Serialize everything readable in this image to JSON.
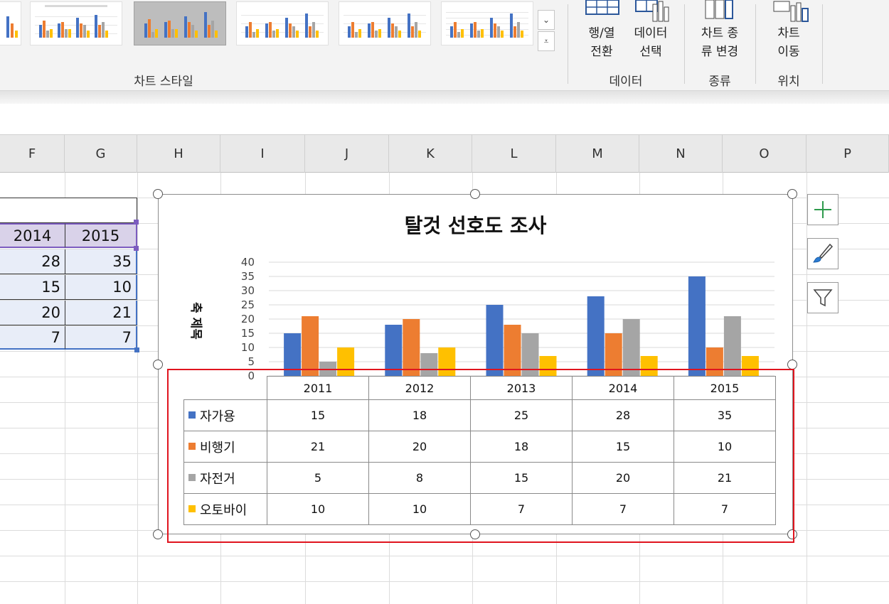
{
  "ribbon": {
    "chart_styles_label": "차트 스타일",
    "data_group_label": "데이터",
    "type_group_label": "종류",
    "location_group_label": "위치",
    "switch_row_col": [
      "행/열",
      "전환"
    ],
    "select_data": [
      "데이터",
      "선택"
    ],
    "change_chart_type": [
      "차트 종",
      "류 변경"
    ],
    "move_chart": [
      "차트",
      "이동"
    ]
  },
  "columns": [
    "F",
    "G",
    "H",
    "I",
    "J",
    "K",
    "L",
    "M",
    "N",
    "O",
    "P"
  ],
  "sheet": {
    "header_cells": [
      "2014",
      "2015"
    ],
    "rows": [
      [
        "28",
        "35"
      ],
      [
        "15",
        "10"
      ],
      [
        "20",
        "21"
      ],
      [
        "7",
        "7"
      ]
    ]
  },
  "chart": {
    "title": "탈것 선호도 조사",
    "axis_title": "축 제목",
    "side_buttons": [
      "plus-icon",
      "brush-icon",
      "filter-icon"
    ],
    "table_headers": [
      "2011",
      "2012",
      "2013",
      "2014",
      "2015"
    ]
  },
  "chart_data": {
    "type": "bar",
    "title": "탈것 선호도 조사",
    "ylabel": "축 제목",
    "xlabel": "",
    "categories": [
      "2011",
      "2012",
      "2013",
      "2014",
      "2015"
    ],
    "ylim": [
      0,
      40
    ],
    "yticks": [
      0,
      5,
      10,
      15,
      20,
      25,
      30,
      35,
      40
    ],
    "grid": true,
    "legend": "data-table",
    "series": [
      {
        "name": "자가용",
        "color": "#4472c4",
        "values": [
          15,
          18,
          25,
          28,
          35
        ]
      },
      {
        "name": "비행기",
        "color": "#ed7d31",
        "values": [
          21,
          20,
          18,
          15,
          10
        ]
      },
      {
        "name": "자전거",
        "color": "#a5a5a5",
        "values": [
          5,
          8,
          15,
          20,
          21
        ]
      },
      {
        "name": "오토바이",
        "color": "#ffc000",
        "values": [
          10,
          10,
          7,
          7,
          7
        ]
      }
    ]
  }
}
